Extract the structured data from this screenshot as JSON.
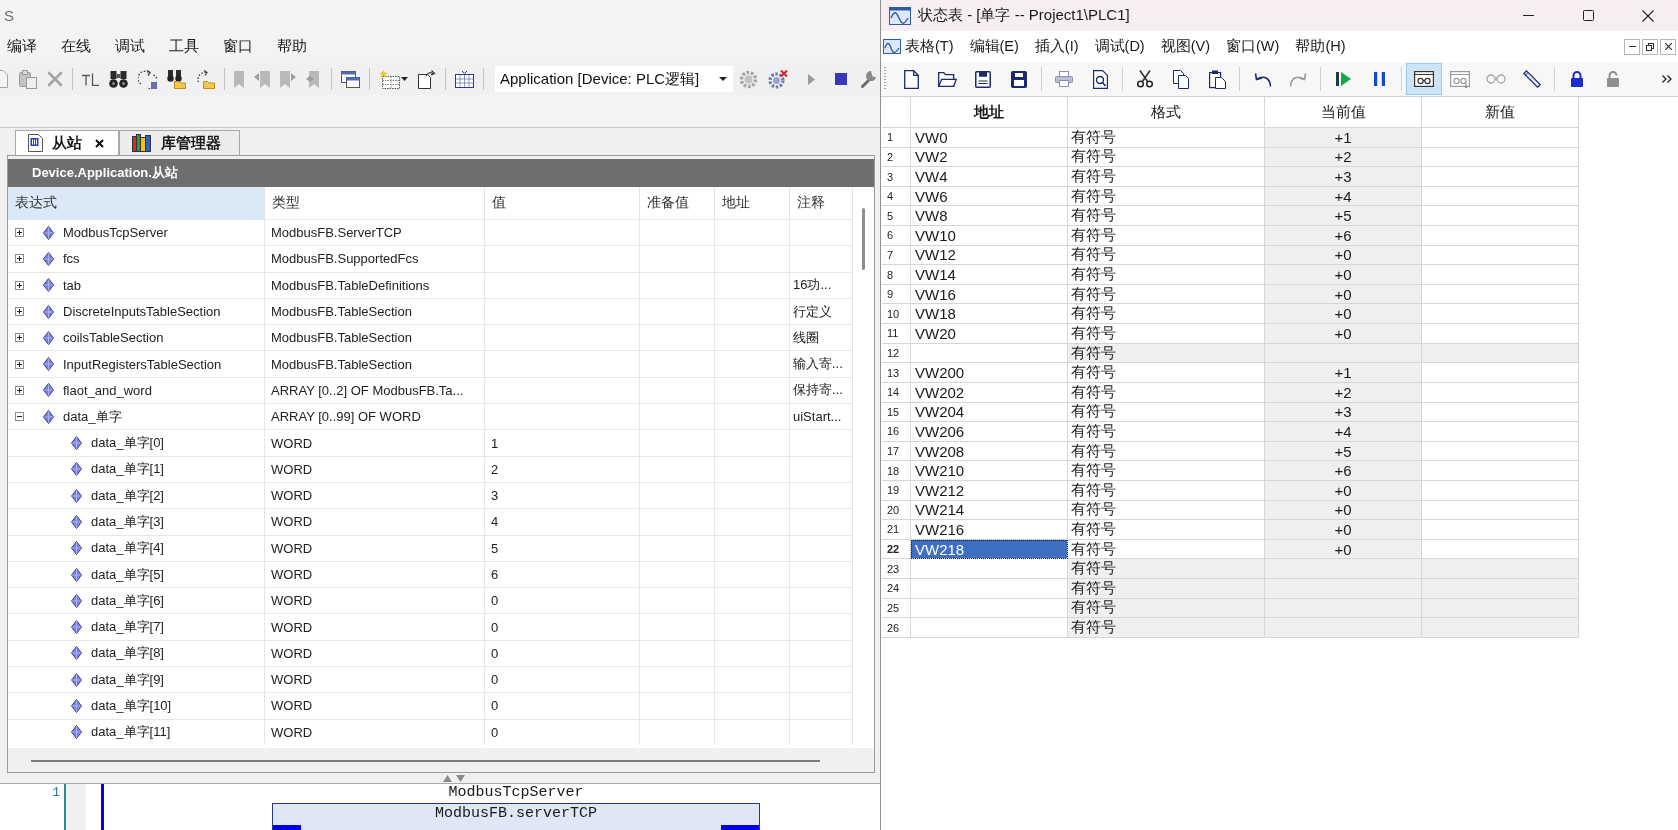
{
  "left_window": {
    "title": "S",
    "menu": [
      "编译",
      "在线",
      "调试",
      "工具",
      "窗口",
      "帮助"
    ],
    "device_selector": {
      "value": "Application [Device: PLC逻辑]"
    },
    "tabs": [
      {
        "label": "从站",
        "kind": "watch",
        "selected": true
      },
      {
        "label": "库管理器",
        "kind": "library",
        "selected": false
      }
    ],
    "watch_header": "Device.Application.从站",
    "columns": [
      {
        "label": "表达式",
        "selected": true
      },
      {
        "label": "类型",
        "selected": false
      },
      {
        "label": "值",
        "selected": false
      },
      {
        "label": "准备值",
        "selected": false
      },
      {
        "label": "地址",
        "selected": false
      },
      {
        "label": "注释",
        "selected": false
      }
    ],
    "rows": [
      {
        "expression": "ModbusTcpServer",
        "type": "ModbusFB.ServerTCP",
        "expanded": false
      },
      {
        "expression": "fcs",
        "type": "ModbusFB.SupportedFcs",
        "expanded": false
      },
      {
        "expression": "tab",
        "type": "ModbusFB.TableDefinitions",
        "comment": "16功...",
        "expanded": false
      },
      {
        "expression": "DiscreteInputsTableSection",
        "type": "ModbusFB.TableSection",
        "comment": "行定义",
        "expanded": false
      },
      {
        "expression": "coilsTableSection",
        "type": "ModbusFB.TableSection",
        "comment": "线圈",
        "expanded": false
      },
      {
        "expression": "InputRegistersTableSection",
        "type": "ModbusFB.TableSection",
        "comment": "输入寄...",
        "expanded": false
      },
      {
        "expression": "flaot_and_word",
        "type": "ARRAY [0..2] OF ModbusFB.Ta...",
        "comment": "保持寄...",
        "expanded": false
      },
      {
        "expression": "data_单字",
        "type": "ARRAY [0..99] OF WORD",
        "comment": "uiStart...",
        "expanded": true,
        "children": [
          {
            "expression": "data_单字[0]",
            "type": "WORD",
            "value": "1"
          },
          {
            "expression": "data_单字[1]",
            "type": "WORD",
            "value": "2"
          },
          {
            "expression": "data_单字[2]",
            "type": "WORD",
            "value": "3"
          },
          {
            "expression": "data_单字[3]",
            "type": "WORD",
            "value": "4"
          },
          {
            "expression": "data_单字[4]",
            "type": "WORD",
            "value": "5"
          },
          {
            "expression": "data_单字[5]",
            "type": "WORD",
            "value": "6"
          },
          {
            "expression": "data_单字[6]",
            "type": "WORD",
            "value": "0"
          },
          {
            "expression": "data_单字[7]",
            "type": "WORD",
            "value": "0"
          },
          {
            "expression": "data_单字[8]",
            "type": "WORD",
            "value": "0"
          },
          {
            "expression": "data_单字[9]",
            "type": "WORD",
            "value": "0"
          },
          {
            "expression": "data_单字[10]",
            "type": "WORD",
            "value": "0"
          },
          {
            "expression": "data_单字[11]",
            "type": "WORD",
            "value": "0"
          }
        ]
      }
    ],
    "editor": {
      "line_number": "1",
      "instance_name": "ModbusTcpServer",
      "block_type": "ModbusFB.serverTCP"
    }
  },
  "right_window": {
    "title": "状态表 - [单字 -- Project1\\PLC1]",
    "menu": [
      "表格(T)",
      "编辑(E)",
      "插入(I)",
      "调试(D)",
      "视图(V)",
      "窗口(W)",
      "帮助(H)"
    ],
    "monitor_toggle": {
      "selected": true
    },
    "columns": [
      {
        "label": "地址",
        "selected": true
      },
      {
        "label": "格式",
        "selected": false
      },
      {
        "label": "当前值",
        "selected": false
      },
      {
        "label": "新值",
        "selected": false
      }
    ],
    "rows": [
      {
        "number": "1",
        "address": "VW0",
        "format": "有符号",
        "current": "+1",
        "kind": "entry",
        "selected": false
      },
      {
        "number": "2",
        "address": "VW2",
        "format": "有符号",
        "current": "+2",
        "kind": "entry",
        "selected": false
      },
      {
        "number": "3",
        "address": "VW4",
        "format": "有符号",
        "current": "+3",
        "kind": "entry",
        "selected": false
      },
      {
        "number": "4",
        "address": "VW6",
        "format": "有符号",
        "current": "+4",
        "kind": "entry",
        "selected": false
      },
      {
        "number": "5",
        "address": "VW8",
        "format": "有符号",
        "current": "+5",
        "kind": "entry",
        "selected": false
      },
      {
        "number": "6",
        "address": "VW10",
        "format": "有符号",
        "current": "+6",
        "kind": "entry",
        "selected": false
      },
      {
        "number": "7",
        "address": "VW12",
        "format": "有符号",
        "current": "+0",
        "kind": "entry",
        "selected": false
      },
      {
        "number": "8",
        "address": "VW14",
        "format": "有符号",
        "current": "+0",
        "kind": "entry",
        "selected": false
      },
      {
        "number": "9",
        "address": "VW16",
        "format": "有符号",
        "current": "+0",
        "kind": "entry",
        "selected": false
      },
      {
        "number": "10",
        "address": "VW18",
        "format": "有符号",
        "current": "+0",
        "kind": "entry",
        "selected": false
      },
      {
        "number": "11",
        "address": "VW20",
        "format": "有符号",
        "current": "+0",
        "kind": "entry",
        "selected": false
      },
      {
        "number": "12",
        "format": "有符号",
        "kind": "blank",
        "selected": false
      },
      {
        "number": "13",
        "address": "VW200",
        "format": "有符号",
        "current": "+1",
        "kind": "entry",
        "selected": false
      },
      {
        "number": "14",
        "address": "VW202",
        "format": "有符号",
        "current": "+2",
        "kind": "entry",
        "selected": false
      },
      {
        "number": "15",
        "address": "VW204",
        "format": "有符号",
        "current": "+3",
        "kind": "entry",
        "selected": false
      },
      {
        "number": "16",
        "address": "VW206",
        "format": "有符号",
        "current": "+4",
        "kind": "entry",
        "selected": false
      },
      {
        "number": "17",
        "address": "VW208",
        "format": "有符号",
        "current": "+5",
        "kind": "entry",
        "selected": false
      },
      {
        "number": "18",
        "address": "VW210",
        "format": "有符号",
        "current": "+6",
        "kind": "entry",
        "selected": false
      },
      {
        "number": "19",
        "address": "VW212",
        "format": "有符号",
        "current": "+0",
        "kind": "entry",
        "selected": false
      },
      {
        "number": "20",
        "address": "VW214",
        "format": "有符号",
        "current": "+0",
        "kind": "entry",
        "selected": false
      },
      {
        "number": "21",
        "address": "VW216",
        "format": "有符号",
        "current": "+0",
        "kind": "entry",
        "selected": false
      },
      {
        "number": "22",
        "address": "VW218",
        "format": "有符号",
        "current": "+0",
        "kind": "entry",
        "selected": true
      },
      {
        "number": "23",
        "format": "有符号",
        "kind": "blank",
        "selected": false
      },
      {
        "number": "24",
        "format": "有符号",
        "kind": "blank",
        "selected": false
      },
      {
        "number": "25",
        "format": "有符号",
        "kind": "blank",
        "selected": false
      },
      {
        "number": "26",
        "format": "有符号",
        "kind": "blank",
        "selected": false
      }
    ]
  }
}
